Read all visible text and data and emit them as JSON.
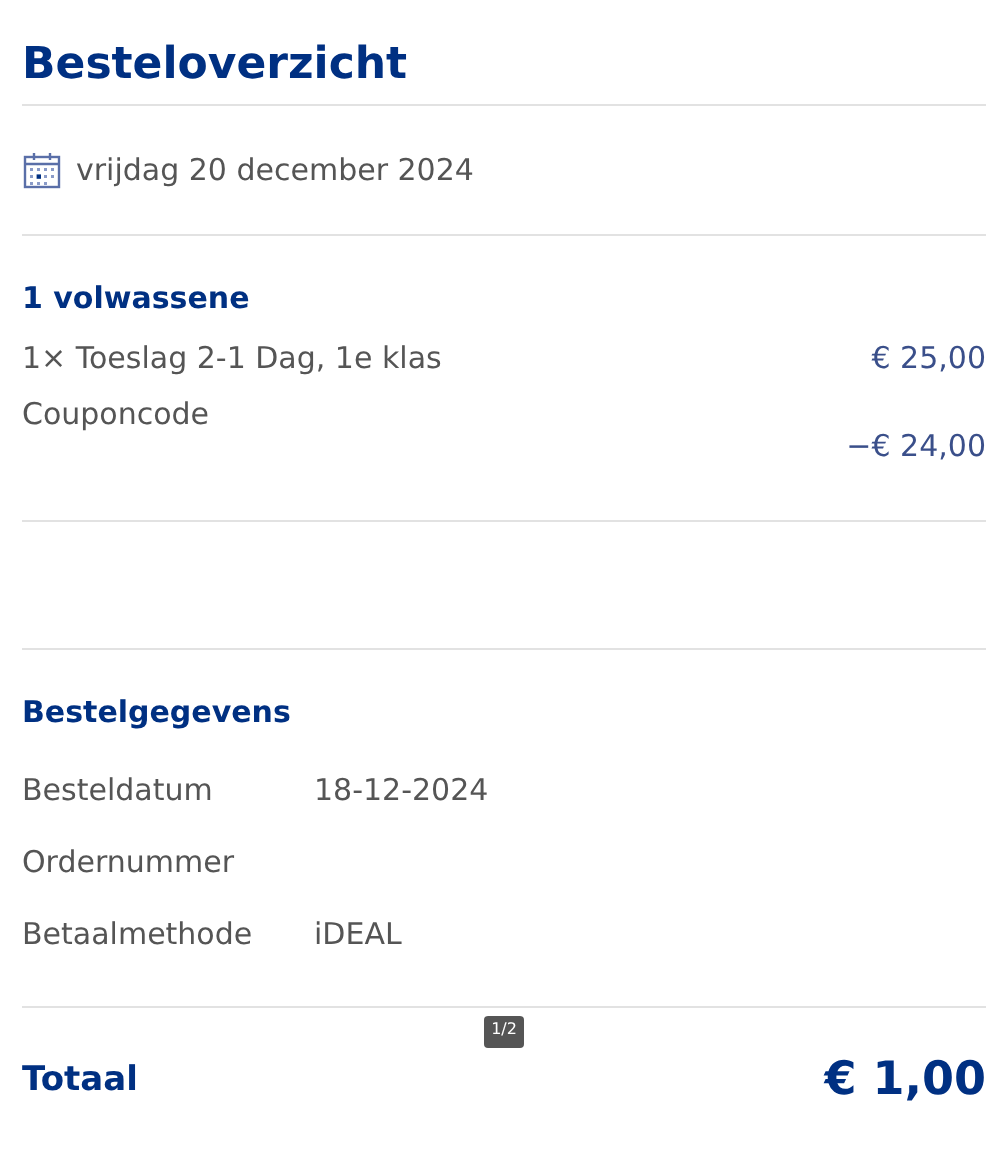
{
  "title": "Besteloverzicht",
  "date": "vrijdag 20 december 2024",
  "traveller_group": {
    "heading": "1 volwassene",
    "lines": [
      {
        "label": "1× Toeslag 2-1 Dag, 1e klas",
        "amount": "€ 25,00",
        "kind": "inline"
      },
      {
        "label": "Couponcode",
        "amount": "−€ 24,00",
        "kind": "below"
      }
    ]
  },
  "order_details": {
    "heading": "Bestelgegevens",
    "rows": [
      {
        "label": "Besteldatum",
        "value": "18-12-2024"
      },
      {
        "label": "Ordernummer"
      },
      {
        "label": "Betaalmethode",
        "value": "iDEAL"
      }
    ]
  },
  "page_indicator": "1/2",
  "total": {
    "label": "Totaal",
    "amount": "€ 1,00"
  }
}
